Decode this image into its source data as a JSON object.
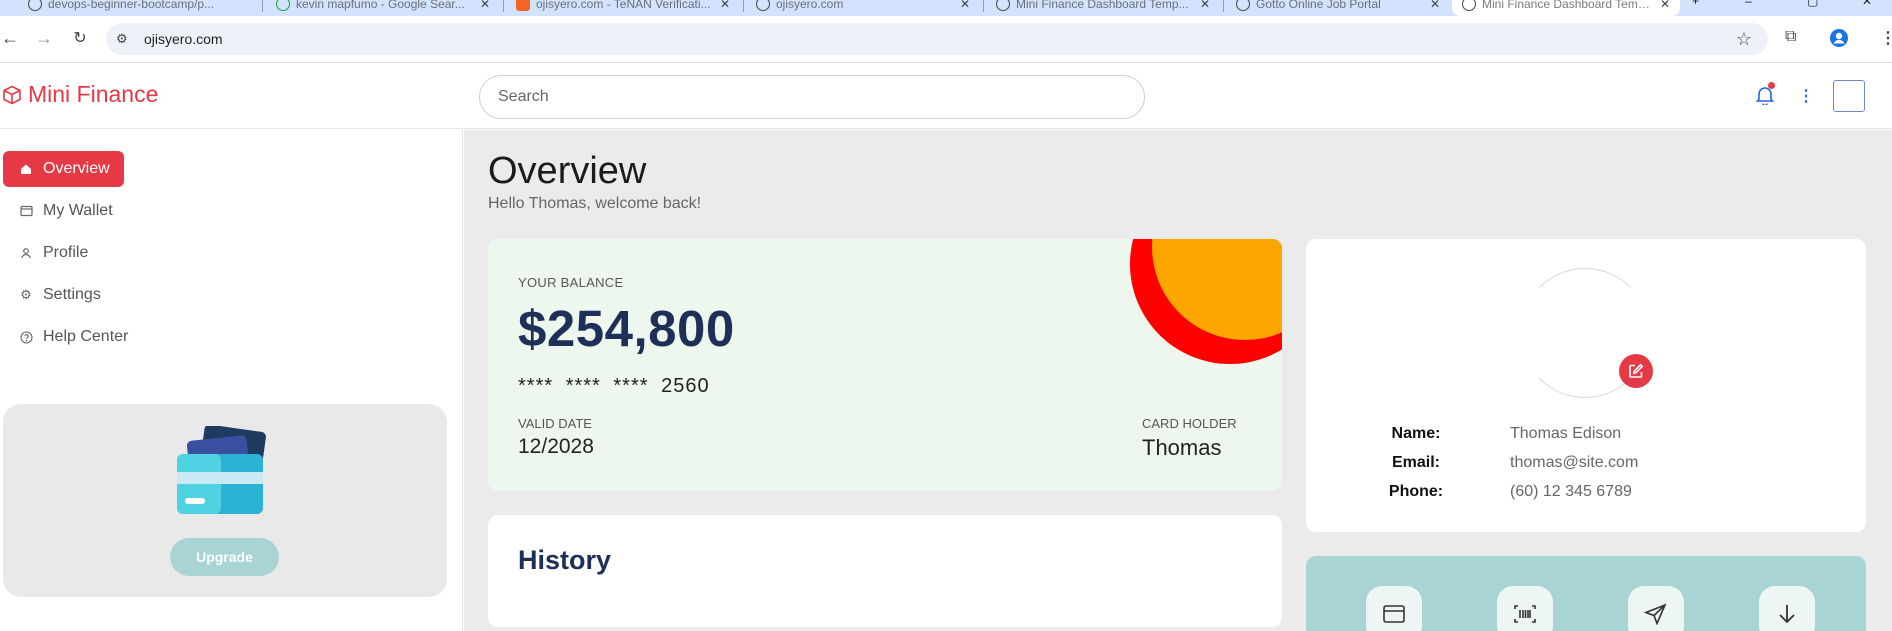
{
  "browser": {
    "tabs": [
      {
        "title": "devops-beginner-bootcamp/p..."
      },
      {
        "title": "kevin mapfumo - Google Sear..."
      },
      {
        "title": "ojisyero.com - TeNAN Verificati..."
      },
      {
        "title": "ojisyero.com"
      },
      {
        "title": "Mini Finance Dashboard Temp..."
      },
      {
        "title": "Gotto Online Job Portal"
      },
      {
        "title": "Mini Finance Dashboard Temp..."
      }
    ],
    "url": "ojisyero.com"
  },
  "header": {
    "brand": "Mini Finance",
    "search_placeholder": "Search"
  },
  "sidebar": {
    "items": [
      {
        "label": "Overview",
        "icon": "home-icon"
      },
      {
        "label": "My Wallet",
        "icon": "wallet-icon"
      },
      {
        "label": "Profile",
        "icon": "user-icon"
      },
      {
        "label": "Settings",
        "icon": "gear-icon"
      },
      {
        "label": "Help Center",
        "icon": "help-icon"
      }
    ],
    "upgrade_label": "Upgrade"
  },
  "main": {
    "title": "Overview",
    "subtitle": "Hello Thomas, welcome back!",
    "balance": {
      "label": "YOUR BALANCE",
      "amount": "$254,800",
      "card_number": "**** **** **** 2560",
      "valid_label": "VALID DATE",
      "valid_value": "12/2028",
      "holder_label": "CARD HOLDER",
      "holder_value": "Thomas"
    },
    "history_title": "History",
    "profile": {
      "name_label": "Name:",
      "name": "Thomas Edison",
      "email_label": "Email:",
      "email": "thomas@site.com",
      "phone_label": "Phone:",
      "phone": "(60) 12 345 6789"
    }
  },
  "colors": {
    "accent": "#e63946",
    "navy": "#1e2f58",
    "teal": "#a8d4d4",
    "orange": "#ffa500",
    "red": "#ff0000"
  }
}
